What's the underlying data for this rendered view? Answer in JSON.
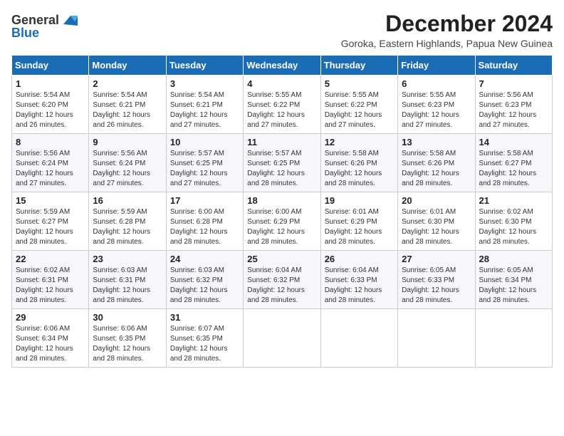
{
  "logo": {
    "general": "General",
    "blue": "Blue"
  },
  "header": {
    "title": "December 2024",
    "subtitle": "Goroka, Eastern Highlands, Papua New Guinea"
  },
  "weekdays": [
    "Sunday",
    "Monday",
    "Tuesday",
    "Wednesday",
    "Thursday",
    "Friday",
    "Saturday"
  ],
  "weeks": [
    [
      {
        "day": "1",
        "sunrise": "5:54 AM",
        "sunset": "6:20 PM",
        "daylight": "12 hours and 26 minutes."
      },
      {
        "day": "2",
        "sunrise": "5:54 AM",
        "sunset": "6:21 PM",
        "daylight": "12 hours and 26 minutes."
      },
      {
        "day": "3",
        "sunrise": "5:54 AM",
        "sunset": "6:21 PM",
        "daylight": "12 hours and 27 minutes."
      },
      {
        "day": "4",
        "sunrise": "5:55 AM",
        "sunset": "6:22 PM",
        "daylight": "12 hours and 27 minutes."
      },
      {
        "day": "5",
        "sunrise": "5:55 AM",
        "sunset": "6:22 PM",
        "daylight": "12 hours and 27 minutes."
      },
      {
        "day": "6",
        "sunrise": "5:55 AM",
        "sunset": "6:23 PM",
        "daylight": "12 hours and 27 minutes."
      },
      {
        "day": "7",
        "sunrise": "5:56 AM",
        "sunset": "6:23 PM",
        "daylight": "12 hours and 27 minutes."
      }
    ],
    [
      {
        "day": "8",
        "sunrise": "5:56 AM",
        "sunset": "6:24 PM",
        "daylight": "12 hours and 27 minutes."
      },
      {
        "day": "9",
        "sunrise": "5:56 AM",
        "sunset": "6:24 PM",
        "daylight": "12 hours and 27 minutes."
      },
      {
        "day": "10",
        "sunrise": "5:57 AM",
        "sunset": "6:25 PM",
        "daylight": "12 hours and 27 minutes."
      },
      {
        "day": "11",
        "sunrise": "5:57 AM",
        "sunset": "6:25 PM",
        "daylight": "12 hours and 28 minutes."
      },
      {
        "day": "12",
        "sunrise": "5:58 AM",
        "sunset": "6:26 PM",
        "daylight": "12 hours and 28 minutes."
      },
      {
        "day": "13",
        "sunrise": "5:58 AM",
        "sunset": "6:26 PM",
        "daylight": "12 hours and 28 minutes."
      },
      {
        "day": "14",
        "sunrise": "5:58 AM",
        "sunset": "6:27 PM",
        "daylight": "12 hours and 28 minutes."
      }
    ],
    [
      {
        "day": "15",
        "sunrise": "5:59 AM",
        "sunset": "6:27 PM",
        "daylight": "12 hours and 28 minutes."
      },
      {
        "day": "16",
        "sunrise": "5:59 AM",
        "sunset": "6:28 PM",
        "daylight": "12 hours and 28 minutes."
      },
      {
        "day": "17",
        "sunrise": "6:00 AM",
        "sunset": "6:28 PM",
        "daylight": "12 hours and 28 minutes."
      },
      {
        "day": "18",
        "sunrise": "6:00 AM",
        "sunset": "6:29 PM",
        "daylight": "12 hours and 28 minutes."
      },
      {
        "day": "19",
        "sunrise": "6:01 AM",
        "sunset": "6:29 PM",
        "daylight": "12 hours and 28 minutes."
      },
      {
        "day": "20",
        "sunrise": "6:01 AM",
        "sunset": "6:30 PM",
        "daylight": "12 hours and 28 minutes."
      },
      {
        "day": "21",
        "sunrise": "6:02 AM",
        "sunset": "6:30 PM",
        "daylight": "12 hours and 28 minutes."
      }
    ],
    [
      {
        "day": "22",
        "sunrise": "6:02 AM",
        "sunset": "6:31 PM",
        "daylight": "12 hours and 28 minutes."
      },
      {
        "day": "23",
        "sunrise": "6:03 AM",
        "sunset": "6:31 PM",
        "daylight": "12 hours and 28 minutes."
      },
      {
        "day": "24",
        "sunrise": "6:03 AM",
        "sunset": "6:32 PM",
        "daylight": "12 hours and 28 minutes."
      },
      {
        "day": "25",
        "sunrise": "6:04 AM",
        "sunset": "6:32 PM",
        "daylight": "12 hours and 28 minutes."
      },
      {
        "day": "26",
        "sunrise": "6:04 AM",
        "sunset": "6:33 PM",
        "daylight": "12 hours and 28 minutes."
      },
      {
        "day": "27",
        "sunrise": "6:05 AM",
        "sunset": "6:33 PM",
        "daylight": "12 hours and 28 minutes."
      },
      {
        "day": "28",
        "sunrise": "6:05 AM",
        "sunset": "6:34 PM",
        "daylight": "12 hours and 28 minutes."
      }
    ],
    [
      {
        "day": "29",
        "sunrise": "6:06 AM",
        "sunset": "6:34 PM",
        "daylight": "12 hours and 28 minutes."
      },
      {
        "day": "30",
        "sunrise": "6:06 AM",
        "sunset": "6:35 PM",
        "daylight": "12 hours and 28 minutes."
      },
      {
        "day": "31",
        "sunrise": "6:07 AM",
        "sunset": "6:35 PM",
        "daylight": "12 hours and 28 minutes."
      },
      null,
      null,
      null,
      null
    ]
  ]
}
